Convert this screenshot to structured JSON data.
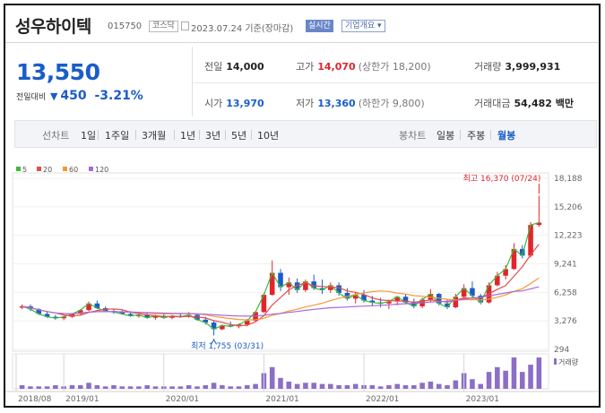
{
  "header": {
    "name": "성우하이텍",
    "code": "015750",
    "market": "코스닥",
    "date": "2023.07.24 기준(장마감)",
    "realtime": "실시간",
    "company_info": "기업개요 ▾"
  },
  "price": {
    "current": "13,550",
    "change_label": "전일대비",
    "change_icon": "down-triangle-icon",
    "change_amount": "450",
    "change_rate": "-3.21%"
  },
  "stats": {
    "prev_label": "전일",
    "prev_value": "14,000",
    "high_label": "고가",
    "high_value": "14,070",
    "upper_limit": "(상한가 18,200)",
    "volume_label": "거래량",
    "volume_value": "3,999,931",
    "open_label": "시가",
    "open_value": "13,970",
    "low_label": "저가",
    "low_value": "13,360",
    "lower_limit": "(하한가 9,800)",
    "amount_label": "거래대금",
    "amount_value": "54,482 백만"
  },
  "periods": {
    "line_label": "선차트",
    "items": [
      "1일",
      "1주일",
      "3개월",
      "1년",
      "3년",
      "5년",
      "10년"
    ],
    "candle_label": "봉차트",
    "candle_items": [
      "일봉",
      "주봉",
      "월봉"
    ],
    "active_candle": "월봉"
  },
  "chart_data": {
    "type": "candlestick",
    "legend": [
      {
        "name": "5",
        "color": "#3cb93c"
      },
      {
        "name": "20",
        "color": "#e84b4b"
      },
      {
        "name": "60",
        "color": "#f59a2f"
      },
      {
        "name": "120",
        "color": "#a86ad8"
      }
    ],
    "y_ticks": [
      "18,188",
      "15,206",
      "12,223",
      "9,241",
      "6,258",
      "3,276",
      "294"
    ],
    "ylim": [
      294,
      18188
    ],
    "x_ticks": [
      "2018/08",
      "2019/01",
      "2020/01",
      "2021/01",
      "2022/01",
      "2023/01"
    ],
    "volume_label": "거래량",
    "max_annotation": "최고 16,370 (07/24)",
    "min_annotation": "최저 1,755 (03/31)",
    "up_color": "#e3242b",
    "down_color": "#1a5dc8",
    "candles": [
      [
        4700,
        5000,
        4500,
        4800
      ],
      [
        4800,
        5000,
        4300,
        4500
      ],
      [
        4500,
        4600,
        3900,
        4000
      ],
      [
        4000,
        4300,
        3600,
        3700
      ],
      [
        3700,
        3900,
        3400,
        3550
      ],
      [
        3550,
        3800,
        3350,
        3700
      ],
      [
        3700,
        4100,
        3600,
        4000
      ],
      [
        4000,
        4500,
        3900,
        4400
      ],
      [
        4400,
        5300,
        4300,
        5100
      ],
      [
        5100,
        5400,
        4500,
        4600
      ],
      [
        4600,
        4800,
        4200,
        4300
      ],
      [
        4300,
        4500,
        4000,
        4200
      ],
      [
        4200,
        4400,
        3900,
        4000
      ],
      [
        4000,
        4300,
        3700,
        3800
      ],
      [
        3800,
        4100,
        3600,
        3900
      ],
      [
        3900,
        4200,
        3500,
        3600
      ],
      [
        3600,
        3900,
        3400,
        3800
      ],
      [
        3800,
        4000,
        3500,
        3600
      ],
      [
        3600,
        3900,
        3450,
        3800
      ],
      [
        3800,
        4100,
        3600,
        3700
      ],
      [
        3700,
        4200,
        3600,
        3900
      ],
      [
        3900,
        4000,
        3300,
        3400
      ],
      [
        3400,
        3700,
        2900,
        3100
      ],
      [
        3100,
        3300,
        1755,
        2400
      ],
      [
        2400,
        2900,
        2300,
        2800
      ],
      [
        2800,
        3200,
        2600,
        2700
      ],
      [
        2700,
        3000,
        2500,
        2900
      ],
      [
        2900,
        3500,
        2700,
        3300
      ],
      [
        3300,
        4300,
        3200,
        4200
      ],
      [
        4200,
        6200,
        4100,
        6000
      ],
      [
        6000,
        9600,
        5900,
        8300
      ],
      [
        8300,
        8700,
        6400,
        6800
      ],
      [
        6800,
        7800,
        6000,
        7300
      ],
      [
        7300,
        7700,
        6200,
        6500
      ],
      [
        6500,
        7600,
        6300,
        7400
      ],
      [
        7400,
        8100,
        6500,
        6700
      ],
      [
        6700,
        7600,
        6100,
        6500
      ],
      [
        6500,
        7300,
        6200,
        7000
      ],
      [
        7000,
        7300,
        5900,
        6200
      ],
      [
        6200,
        6700,
        5400,
        5600
      ],
      [
        5600,
        6300,
        5100,
        6000
      ],
      [
        6000,
        6500,
        5200,
        5400
      ],
      [
        5400,
        5900,
        4800,
        5200
      ],
      [
        5200,
        5700,
        4700,
        5100
      ],
      [
        5100,
        5500,
        4500,
        5300
      ],
      [
        5300,
        5900,
        4900,
        5800
      ],
      [
        5800,
        6100,
        5000,
        5200
      ],
      [
        5200,
        5600,
        4600,
        4800
      ],
      [
        4800,
        5700,
        4600,
        5500
      ],
      [
        5500,
        6600,
        5300,
        6100
      ],
      [
        6100,
        6200,
        4900,
        5100
      ],
      [
        5100,
        5500,
        4500,
        4700
      ],
      [
        4700,
        6100,
        4600,
        5800
      ],
      [
        5800,
        7100,
        5600,
        6700
      ],
      [
        6700,
        7400,
        5700,
        5900
      ],
      [
        5900,
        6100,
        5000,
        5200
      ],
      [
        5200,
        7300,
        5100,
        7000
      ],
      [
        7000,
        8400,
        6900,
        8000
      ],
      [
        8000,
        9100,
        7600,
        8700
      ],
      [
        8700,
        11400,
        8600,
        10800
      ],
      [
        10800,
        11200,
        9800,
        10100
      ],
      [
        10100,
        13600,
        9900,
        13300
      ],
      [
        13300,
        16370,
        13100,
        13550
      ]
    ],
    "volumes": [
      3,
      2,
      2,
      2,
      3,
      2,
      3,
      3,
      5,
      3,
      2,
      3,
      2,
      2,
      2,
      3,
      2,
      2,
      2,
      2,
      3,
      2,
      3,
      5,
      3,
      2,
      2,
      3,
      4,
      13,
      18,
      9,
      6,
      4,
      5,
      5,
      4,
      4,
      3,
      3,
      4,
      3,
      3,
      2,
      3,
      4,
      3,
      3,
      5,
      6,
      4,
      3,
      7,
      13,
      8,
      4,
      14,
      18,
      15,
      26,
      14,
      20,
      26
    ]
  }
}
